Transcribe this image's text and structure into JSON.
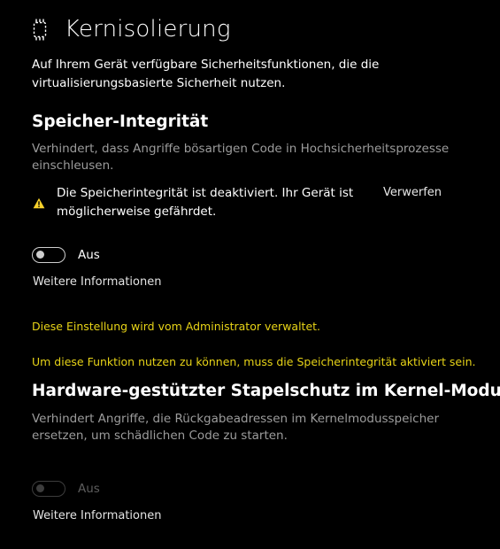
{
  "header": {
    "title": "Kernisolierung",
    "icon": "core-isolation-chip-icon"
  },
  "intro": "Auf Ihrem Gerät verfügbare Sicherheitsfunktionen, die die virtualisierungsbasierte Sicherheit nutzen.",
  "memory_integrity": {
    "title": "Speicher-Integrität",
    "description": "Verhindert, dass Angriffe bösartigen Code in Hochsicherheitsprozesse einschleusen.",
    "warning": {
      "icon": "warning-icon",
      "text": "Die Speicherintegrität ist deaktiviert. Ihr Gerät ist möglicherweise gefährdet.",
      "dismiss_label": "Verwerfen",
      "icon_color": "#f7d12b"
    },
    "toggle": {
      "state_label": "Aus",
      "on": false,
      "disabled": false
    },
    "more_info_label": "Weitere Informationen",
    "admin_note": "Diese Einstellung wird vom Administrator verwaltet.",
    "requirement_note": "Um diese Funktion nutzen zu können, muss die Speicherintegrität aktiviert sein."
  },
  "stack_protection": {
    "title": "Hardware-gestützter Stapelschutz im Kernel-Modus",
    "description": "Verhindert Angriffe, die Rückgabeadressen im Kernelmodusspeicher ersetzen, um schädlichen Code zu starten.",
    "toggle": {
      "state_label": "Aus",
      "on": false,
      "disabled": true
    },
    "more_info_label": "Weitere Informationen"
  },
  "colors": {
    "background": "#000000",
    "text": "#ffffff",
    "secondary_text": "#9c9c9c",
    "admin_note": "#e7d317",
    "warning_icon": "#f7d12b"
  }
}
